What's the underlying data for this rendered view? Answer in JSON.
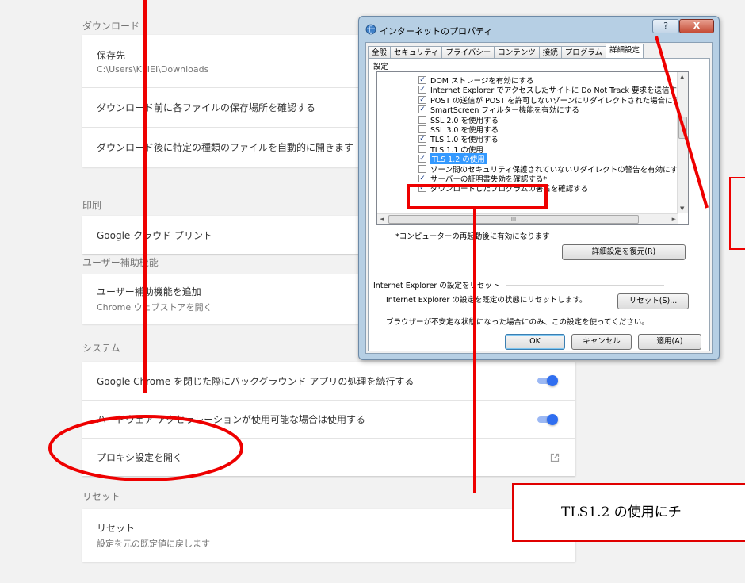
{
  "settings": {
    "download": {
      "title": "ダウンロード",
      "location_label": "保存先",
      "location_value": "C:\\Users\\KEIEI\\Downloads",
      "ask_label": "ダウンロード前に各ファイルの保存場所を確認する",
      "auto_open_label": "ダウンロード後に特定の種類のファイルを自動的に開きます"
    },
    "print": {
      "title": "印刷",
      "cloud_print_label": "Google クラウド プリント"
    },
    "accessibility": {
      "title": "ユーザー補助機能",
      "add_label": "ユーザー補助機能を追加",
      "add_sub": "Chrome ウェブストアを開く"
    },
    "system": {
      "title": "システム",
      "background_label": "Google Chrome を閉じた際にバックグラウンド アプリの処理を続行する",
      "background_on": true,
      "hw_accel_label": "ハードウェア アクセラレーションが使用可能な場合は使用する",
      "hw_accel_on": true,
      "proxy_label": "プロキシ設定を開く"
    },
    "reset": {
      "title": "リセット",
      "reset_label": "リセット",
      "reset_sub": "設定を元の既定値に戻します"
    }
  },
  "dialog": {
    "title": "インターネットのプロパティ",
    "help_button": "?",
    "close_button": "X",
    "tabs": [
      "全般",
      "セキュリティ",
      "プライバシー",
      "コンテンツ",
      "接続",
      "プログラム",
      "詳細設定"
    ],
    "active_tab": "詳細設定",
    "settings_group_label": "設定",
    "list_items": [
      {
        "label": "DOM ストレージを有効にする",
        "checked": true,
        "selected": false
      },
      {
        "label": "Internet Explorer でアクセスしたサイトに Do Not Track 要求を送信す",
        "checked": true,
        "selected": false
      },
      {
        "label": "POST の送信が POST を許可しないゾーンにリダイレクトされた場合に警",
        "checked": true,
        "selected": false
      },
      {
        "label": "SmartScreen フィルター機能を有効にする",
        "checked": true,
        "selected": false
      },
      {
        "label": "SSL 2.0 を使用する",
        "checked": false,
        "selected": false
      },
      {
        "label": "SSL 3.0 を使用する",
        "checked": false,
        "selected": false
      },
      {
        "label": "TLS 1.0 を使用する",
        "checked": true,
        "selected": false
      },
      {
        "label": "TLS 1.1 の使用",
        "checked": false,
        "selected": false
      },
      {
        "label": "TLS 1.2 の使用",
        "checked": true,
        "selected": true
      },
      {
        "label": "ゾーン間のセキュリティ保護されていないリダイレクトの警告を有効にする*",
        "checked": false,
        "selected": false
      },
      {
        "label": "サーバーの証明書失効を確認する*",
        "checked": true,
        "selected": false
      },
      {
        "label": "ダウンロードしたプログラムの署名を確認する",
        "checked": true,
        "selected": false
      }
    ],
    "scroll_up": "▲",
    "scroll_down": "▼",
    "scroll_left": "◄",
    "scroll_right": "►",
    "hscroll_grip": "III",
    "restart_note": "*コンピューターの再起動後に有効になります",
    "restore_button": "詳細設定を復元(R)",
    "reset_header": "Internet Explorer の設定をリセット",
    "reset_text": "Internet Explorer の設定を既定の状態にリセットします。",
    "reset_button": "リセット(S)...",
    "reset_warning": "ブラウザーが不安定な状態になった場合にのみ、この設定を使ってください。",
    "ok_button": "OK",
    "cancel_button": "キャンセル",
    "apply_button": "適用(A)"
  },
  "annotation": {
    "callout_text": "TLS1.2 の使用にチ",
    "red_color": "#ee0000"
  }
}
